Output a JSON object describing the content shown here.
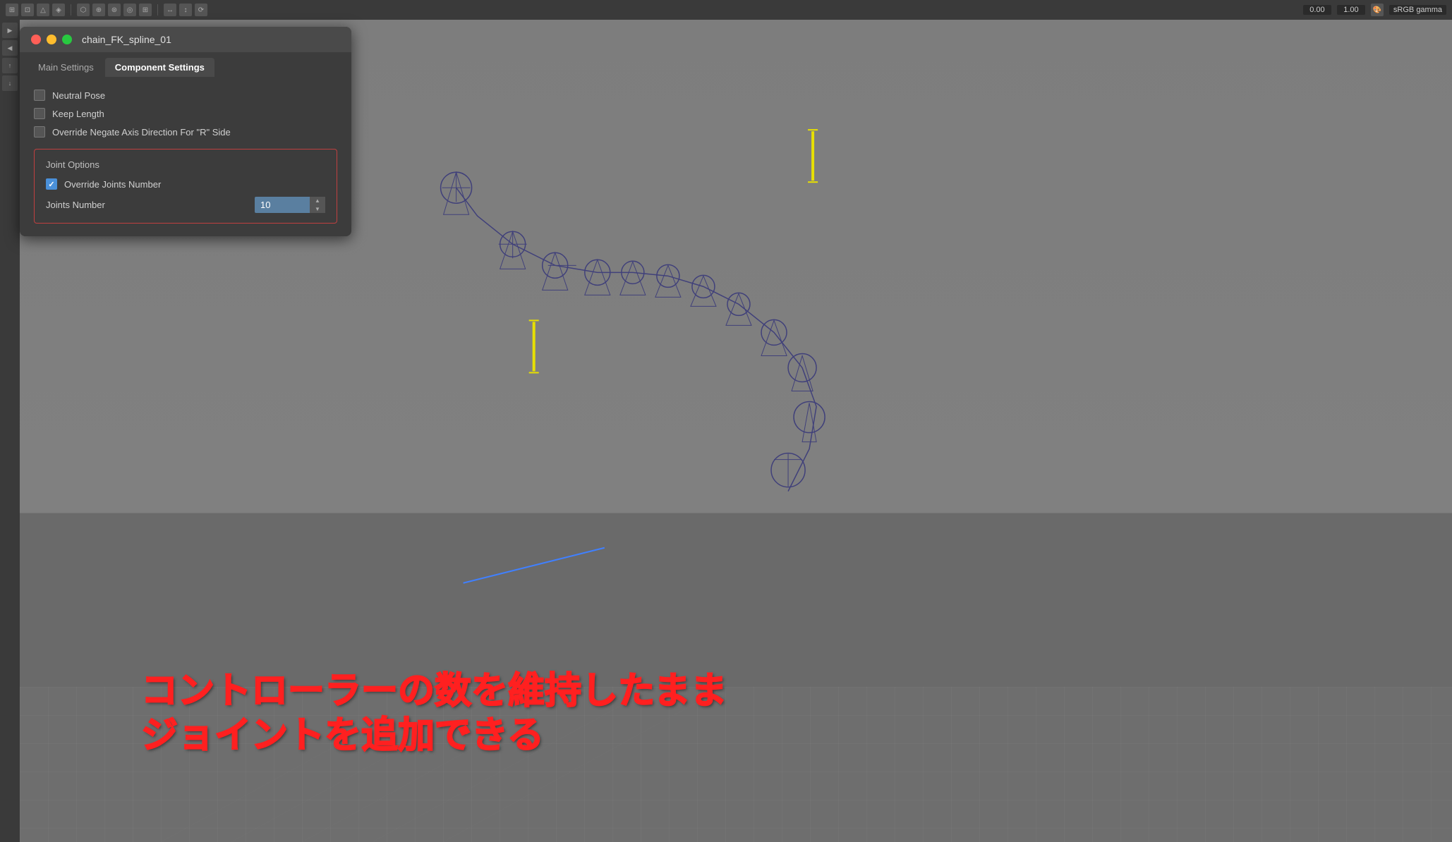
{
  "toolbar": {
    "time_start": "0.00",
    "time_end": "1.00",
    "color_space": "sRGB gamma"
  },
  "window": {
    "title": "chain_FK_spline_01",
    "close_btn": "●",
    "minimize_btn": "●",
    "maximize_btn": "●"
  },
  "tabs": [
    {
      "id": "main",
      "label": "Main Settings",
      "active": false
    },
    {
      "id": "component",
      "label": "Component Settings",
      "active": true
    }
  ],
  "checkboxes": [
    {
      "id": "neutral_pose",
      "label": "Neutral Pose",
      "checked": false
    },
    {
      "id": "keep_length",
      "label": "Keep Length",
      "checked": false
    },
    {
      "id": "override_negate",
      "label": "Override Negate Axis Direction For \"R\" Side",
      "checked": false
    }
  ],
  "joint_options": {
    "section_title": "Joint Options",
    "override_joints": {
      "label": "Override Joints Number",
      "checked": true
    },
    "joints_number": {
      "label": "Joints Number",
      "value": "10"
    }
  },
  "japanese_text": {
    "line1": "コントローラーの数を維持したまま",
    "line2": "ジョイントを追加できる"
  },
  "left_strip": {
    "buttons": [
      "▶",
      "◀",
      "↑",
      "↓"
    ]
  }
}
